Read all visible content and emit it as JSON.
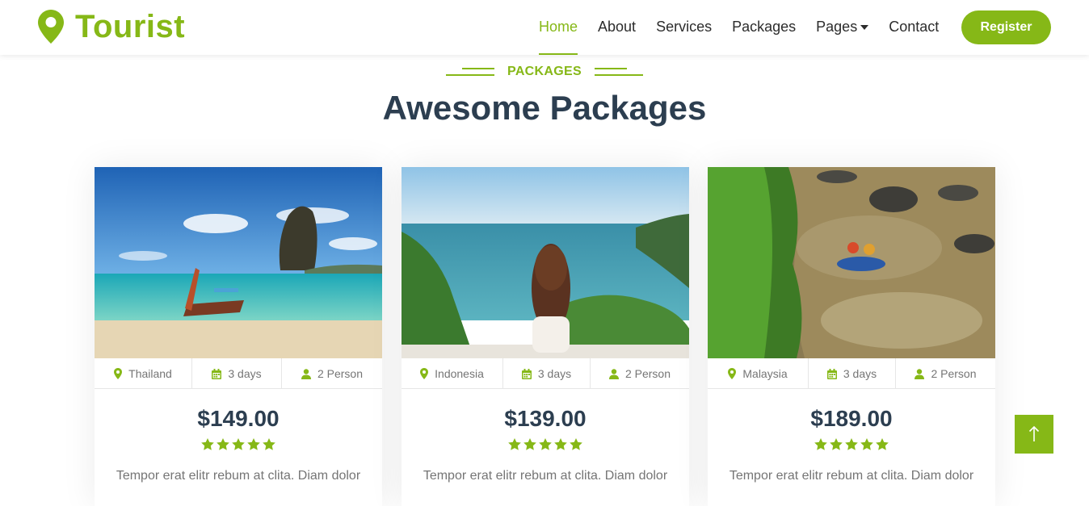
{
  "brand": {
    "name": "Tourist"
  },
  "nav": {
    "items": [
      "Home",
      "About",
      "Services",
      "Packages",
      "Pages",
      "Contact"
    ],
    "active": "Home",
    "register_label": "Register"
  },
  "section": {
    "label": "PACKAGES",
    "title": "Awesome Packages"
  },
  "packages": [
    {
      "location": "Thailand",
      "duration": "3 days",
      "persons": "2 Person",
      "price": "$149.00",
      "rating": 5,
      "description": "Tempor erat elitr rebum at clita. Diam dolor"
    },
    {
      "location": "Indonesia",
      "duration": "3 days",
      "persons": "2 Person",
      "price": "$139.00",
      "rating": 5,
      "description": "Tempor erat elitr rebum at clita. Diam dolor"
    },
    {
      "location": "Malaysia",
      "duration": "3 days",
      "persons": "2 Person",
      "price": "$189.00",
      "rating": 5,
      "description": "Tempor erat elitr rebum at clita. Diam dolor"
    }
  ],
  "icons": {
    "brand": "map-marker-icon",
    "location": "map-marker-icon",
    "duration": "calendar-icon",
    "persons": "user-icon",
    "rating": "star-icon",
    "back_to_top": "arrow-up-icon"
  },
  "colors": {
    "primary": "#86b817",
    "heading": "#2c3e50",
    "text": "#757575"
  }
}
